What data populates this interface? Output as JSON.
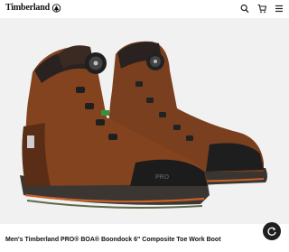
{
  "header": {
    "brand": "Timberland",
    "icons": [
      "search-icon",
      "cart-icon",
      "menu-icon"
    ]
  },
  "product": {
    "title": "Men's Timberland PRO® BOA® Boondock 6\" Composite Toe Work Boot",
    "image_alt": "Pair of brown leather work boots with BOA dials"
  },
  "colors": {
    "leather": "#7a3f1e",
    "toe_cap": "#1e1e1e",
    "outsole_accent": "#c8622a",
    "stage_bg": "#f1f1f1"
  },
  "fab": {
    "icon": "refresh-chat-icon"
  }
}
